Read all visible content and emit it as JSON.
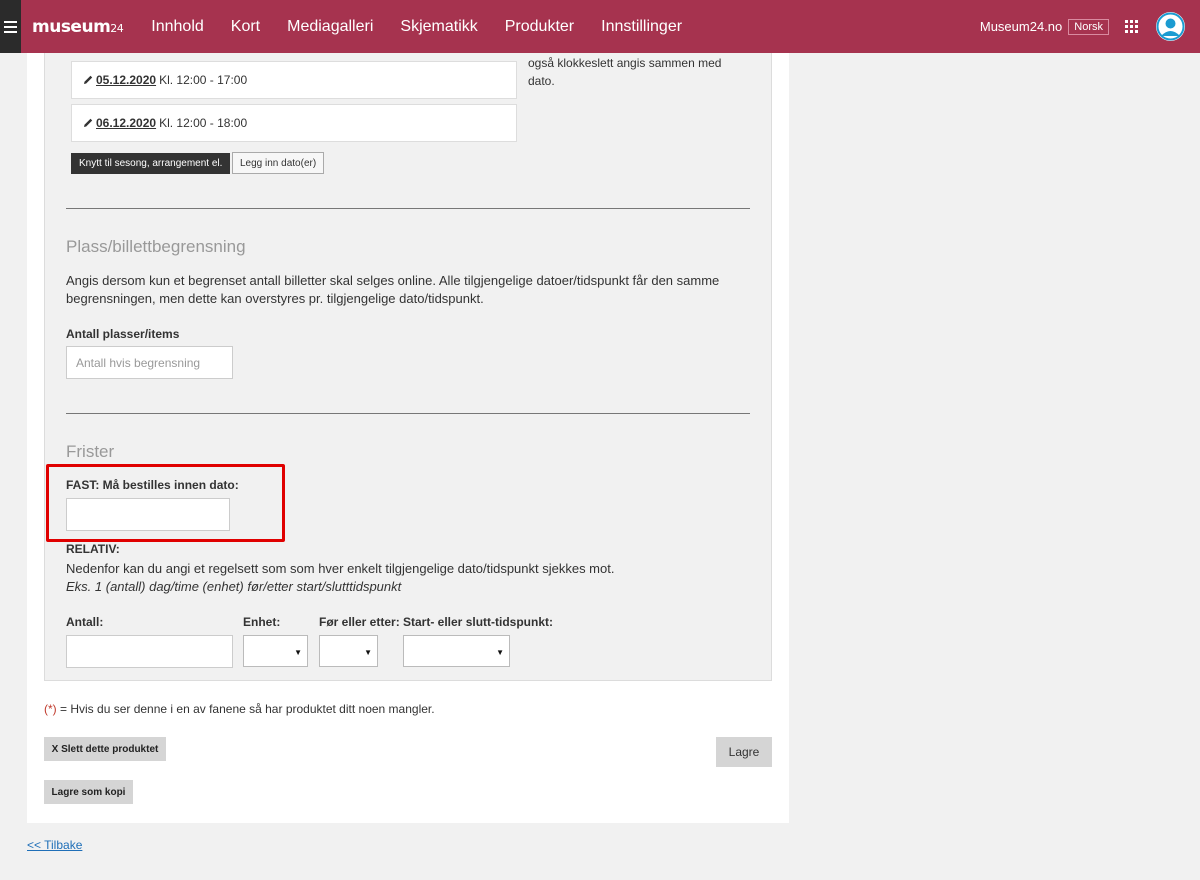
{
  "topbar": {
    "logo_text": "museum",
    "logo_suffix": "24",
    "nav": [
      "Innhold",
      "Kort",
      "Mediagalleri",
      "Skjematikk",
      "Produkter",
      "Innstillinger"
    ],
    "site_link": "Museum24.no",
    "language": "Norsk"
  },
  "dates": {
    "side_note": "også klokkeslett angis sammen med dato.",
    "rows": [
      {
        "date": "05.12.2020",
        "time": "Kl. 12:00 - 17:00"
      },
      {
        "date": "06.12.2020",
        "time": "Kl. 12:00 - 18:00"
      }
    ],
    "btn_link": "Knytt til sesong, arrangement el.",
    "btn_add": "Legg inn dato(er)"
  },
  "capacity": {
    "title": "Plass/billettbegrensning",
    "description": "Angis dersom kun et begrenset antall billetter skal selges online. Alle tilgjengelige datoer/tidspunkt får den samme begrensningen, men dette kan overstyres pr. tilgjengelige dato/tidspunkt.",
    "field_label": "Antall plasser/items",
    "field_placeholder": "Antall hvis begrensning"
  },
  "deadlines": {
    "title": "Frister",
    "fixed_label": "FAST: Må bestilles innen dato:",
    "fixed_value": "",
    "relative_label": "RELATIV:",
    "relative_desc": "Nedenfor kan du angi et regelsett som som hver enkelt tilgjengelige dato/tidspunkt sjekkes mot.",
    "relative_example": "Eks. 1 (antall) dag/time (enhet) før/etter start/slutttidspunkt",
    "col_amount": "Antall:",
    "col_unit": "Enhet:",
    "col_before_after": "Før eller etter:",
    "col_start_end": "Start- eller slutt-tidspunkt:"
  },
  "footer": {
    "required_star": "(*)",
    "required_text": " = Hvis du ser denne i en av fanene så har produktet ditt noen mangler.",
    "delete_button": "X Slett dette produktet",
    "save_button": "Lagre",
    "save_copy_button": "Lagre som kopi",
    "back_link": "<< Tilbake"
  },
  "colors": {
    "topbar": "#a6334f",
    "highlight": "#e00000",
    "link": "#1f6fb8"
  }
}
